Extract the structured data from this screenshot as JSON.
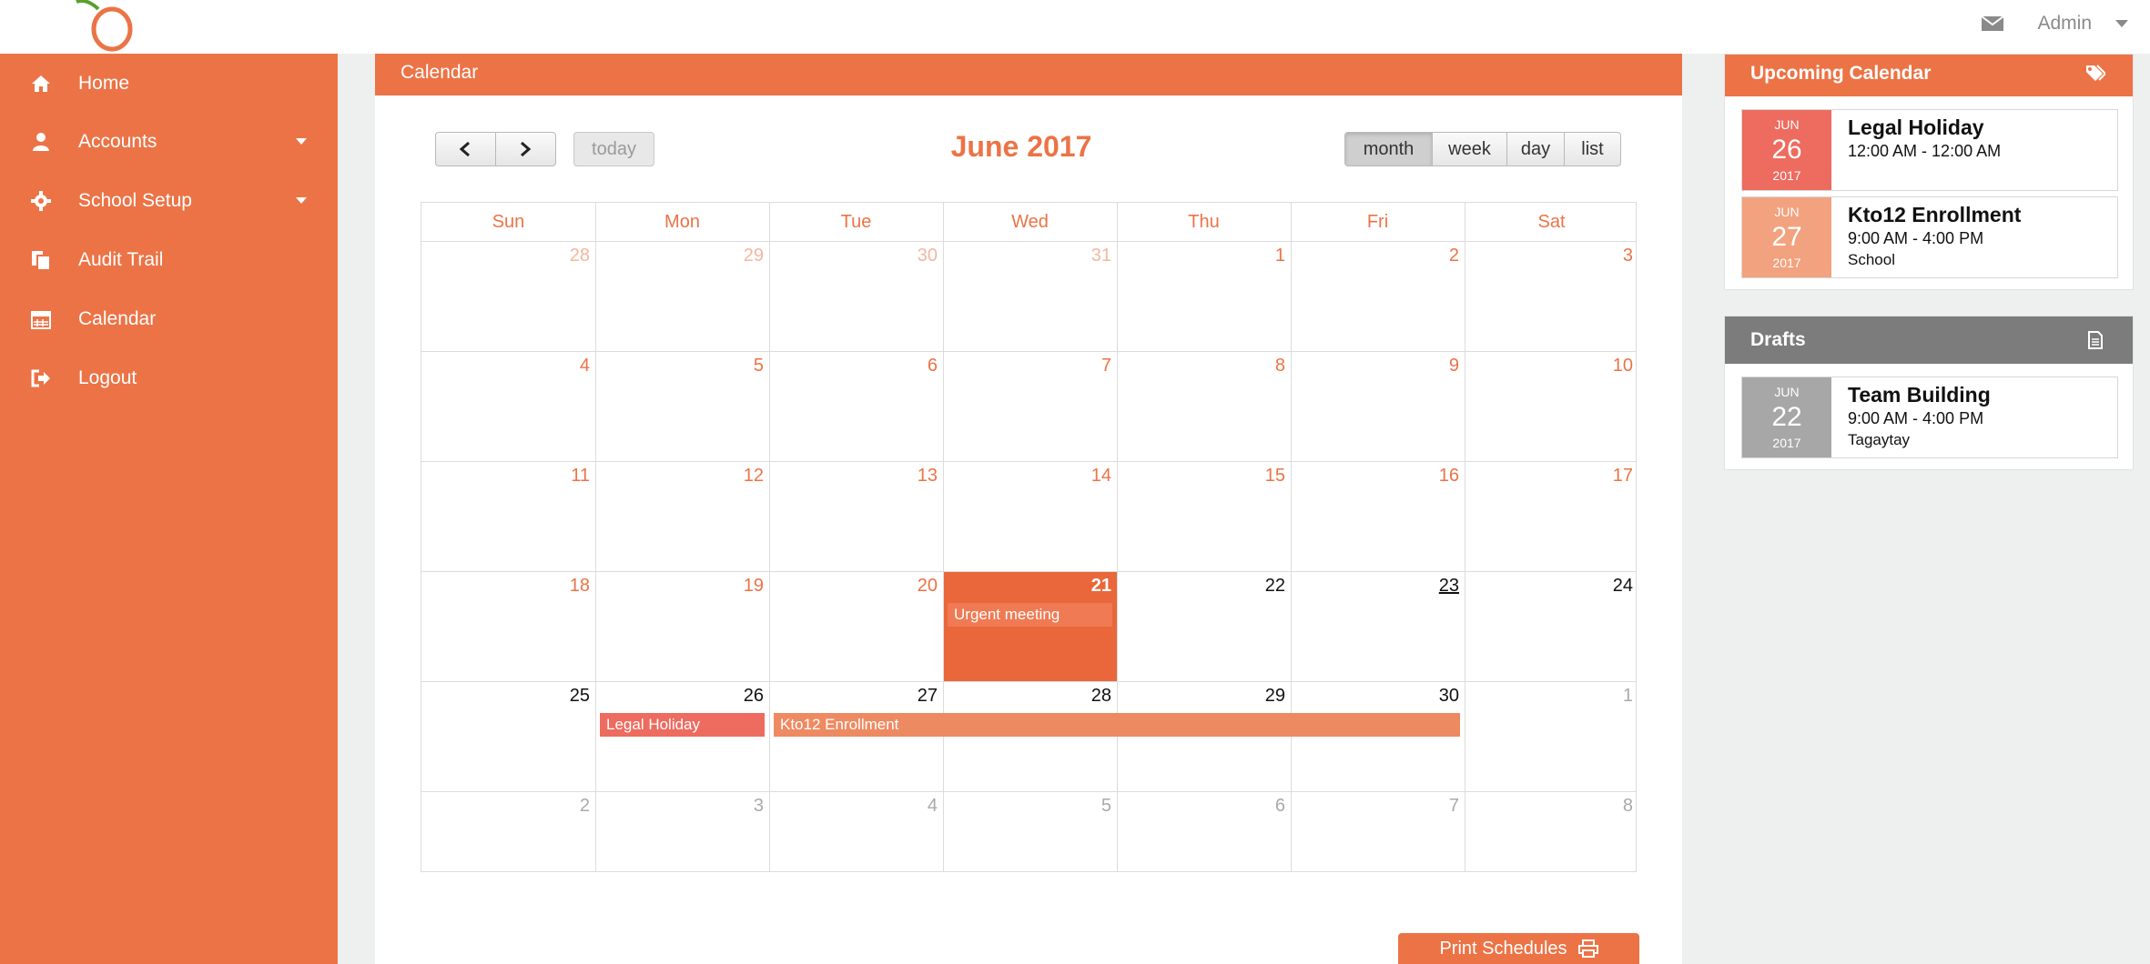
{
  "header": {
    "user_label": "Admin"
  },
  "sidebar": {
    "items": [
      {
        "label": "Home",
        "icon": "home-icon"
      },
      {
        "label": "Accounts",
        "icon": "user-icon"
      },
      {
        "label": "School Setup",
        "icon": "gear-icon"
      },
      {
        "label": "Audit Trail",
        "icon": "files-icon"
      },
      {
        "label": "Calendar",
        "icon": "calendar-icon"
      },
      {
        "label": "Logout",
        "icon": "logout-icon"
      }
    ]
  },
  "calendar": {
    "panel_title": "Calendar",
    "month_title": "June 2017",
    "today_label": "today",
    "views": [
      "month",
      "week",
      "day",
      "list"
    ],
    "active_view": "month",
    "weekdays": [
      "Sun",
      "Mon",
      "Tue",
      "Wed",
      "Thu",
      "Fri",
      "Sat"
    ],
    "weeks": [
      [
        "28",
        "29",
        "30",
        "31",
        "1",
        "2",
        "3"
      ],
      [
        "4",
        "5",
        "6",
        "7",
        "8",
        "9",
        "10"
      ],
      [
        "11",
        "12",
        "13",
        "14",
        "15",
        "16",
        "17"
      ],
      [
        "18",
        "19",
        "20",
        "21",
        "22",
        "23",
        "24"
      ],
      [
        "25",
        "26",
        "27",
        "28",
        "29",
        "30",
        "1"
      ],
      [
        "2",
        "3",
        "4",
        "5",
        "6",
        "7",
        "8"
      ]
    ],
    "events": [
      {
        "title": "Urgent meeting"
      },
      {
        "title": "Legal Holiday"
      },
      {
        "title": "Kto12 Enrollment"
      }
    ],
    "print_label": "Print Schedules"
  },
  "upcoming": {
    "title": "Upcoming Calendar",
    "items": [
      {
        "month": "JUN",
        "day": "26",
        "year": "2017",
        "name": "Legal Holiday",
        "time": "12:00 AM - 12:00 AM",
        "location": "",
        "color": "#ee6b5f"
      },
      {
        "month": "JUN",
        "day": "27",
        "year": "2017",
        "name": "Kto12 Enrollment",
        "time": "9:00 AM - 4:00 PM",
        "location": "School",
        "color": "#f2a27f"
      }
    ]
  },
  "drafts": {
    "title": "Drafts",
    "items": [
      {
        "month": "JUN",
        "day": "22",
        "year": "2017",
        "name": "Team Building",
        "time": "9:00 AM - 4:00 PM",
        "location": "Tagaytay",
        "color": "#a7a7a7"
      }
    ]
  },
  "colors": {
    "brand": "#ec7346",
    "today": "#e9673a",
    "holiday": "#ee6b5f",
    "enrollment": "#ee8a62",
    "draft_header": "#7c7c7c"
  }
}
